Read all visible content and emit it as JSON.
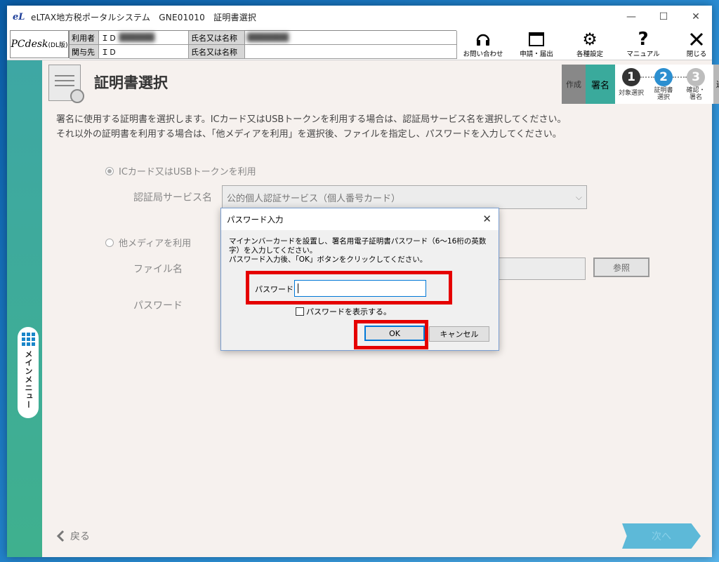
{
  "window": {
    "title": "eLTAX地方税ポータルシステム　GNE01010　証明書選択",
    "app_logo": "eL",
    "controls": {
      "minimize": "—",
      "maximize": "☐",
      "close": "✕"
    }
  },
  "header": {
    "pcdesk": "PCdesk",
    "pcdesk_sub": "(DL版)",
    "user_rows": [
      {
        "label": "利用者",
        "id_label": "ＩＤ",
        "name_label": "氏名又は名称"
      },
      {
        "label": "関与先",
        "id_label": "ＩＤ",
        "name_label": "氏名又は名称"
      }
    ],
    "tools": [
      {
        "label": "お問い合わせ",
        "icon": "headset-icon"
      },
      {
        "label": "申請・届出",
        "icon": "window-icon"
      },
      {
        "label": "各種設定",
        "icon": "gear-icon"
      },
      {
        "label": "マニュアル",
        "icon": "question-icon"
      },
      {
        "label": "閉じる",
        "icon": "close-icon"
      }
    ]
  },
  "sidebar": {
    "main_menu": "メインメニュー"
  },
  "page": {
    "title": "証明書選択",
    "description": [
      "署名に使用する証明書を選択します。ICカード又はUSBトークンを利用する場合は、認証局サービス名を選択してください。",
      "それ以外の証明書を利用する場合は、「他メディアを利用」を選択後、ファイルを指定し、パスワードを入力してください。"
    ],
    "steps": {
      "sakusei": "作成",
      "shomei": "署名",
      "sousin": "送信",
      "items": [
        {
          "num": "1",
          "label": "対象選択"
        },
        {
          "num": "2",
          "label": "証明書\n選択"
        },
        {
          "num": "3",
          "label": "確認・\n署名"
        }
      ]
    },
    "option_ic": "ICカード又はUSBトークンを利用",
    "cert_service_label": "認証局サービス名",
    "cert_service_value": "公的個人認証サービス（個人番号カード）",
    "option_other": "他メディアを利用",
    "file_label": "ファイル名",
    "password_label": "パスワード",
    "ref_button": "参照",
    "back": "戻る",
    "next": "次へ"
  },
  "dialog": {
    "title": "パスワード入力",
    "message_1": "マイナンバーカードを設置し、署名用電子証明書パスワード（6～16桁の英数",
    "message_2": "字）を入力してください。",
    "message_3": "パスワード入力後、「OK」ボタンをクリックしてください。",
    "password_label": "パスワード:",
    "password_value": "",
    "show_password": "パスワードを表示する。",
    "ok": "OK",
    "cancel": "キャンセル"
  },
  "colors": {
    "highlight": "#e50000",
    "accent": "#3aaa9c",
    "focus": "#0078d7"
  }
}
